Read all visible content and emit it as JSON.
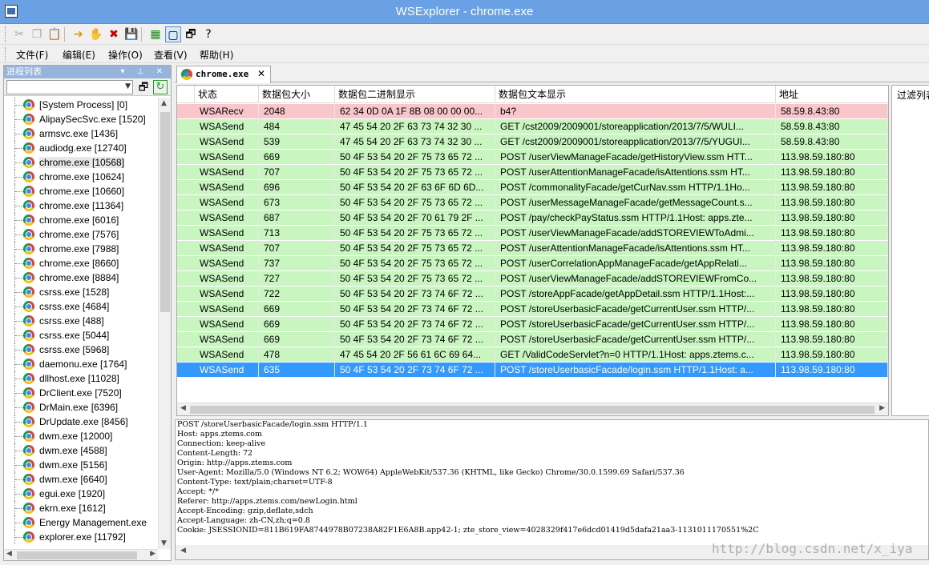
{
  "window": {
    "title": "WSExplorer - chrome.exe"
  },
  "toolbar": {
    "buttons": [
      {
        "name": "cut-icon",
        "glyph": "✂"
      },
      {
        "name": "copy-icon",
        "glyph": "❐"
      },
      {
        "name": "paste-icon",
        "glyph": "📋"
      },
      {
        "name": "arrow-right-icon",
        "glyph": "➜"
      },
      {
        "name": "hand-icon",
        "glyph": "✋"
      },
      {
        "name": "delete-x-icon",
        "glyph": "✖"
      },
      {
        "name": "save-icon",
        "glyph": "💾"
      },
      {
        "name": "tree-view-icon",
        "glyph": "▦"
      },
      {
        "name": "window-icon",
        "glyph": "▢"
      },
      {
        "name": "properties-icon",
        "glyph": "🗗"
      },
      {
        "name": "help-icon",
        "glyph": "?"
      }
    ]
  },
  "menu": [
    "文件(F)",
    "编辑(E)",
    "操作(O)",
    "查看(V)",
    "帮助(H)"
  ],
  "process_pane": {
    "title": "进程列表",
    "header_buttons": "▾ ⊥ ✕",
    "processes": [
      "[System Process] [0]",
      "AlipaySecSvc.exe [1520]",
      "armsvc.exe [1436]",
      "audiodg.exe [12740]",
      "chrome.exe [10568]",
      "chrome.exe [10624]",
      "chrome.exe [10660]",
      "chrome.exe [11364]",
      "chrome.exe [6016]",
      "chrome.exe [7576]",
      "chrome.exe [7988]",
      "chrome.exe [8660]",
      "chrome.exe [8884]",
      "csrss.exe [1528]",
      "csrss.exe [4684]",
      "csrss.exe [488]",
      "csrss.exe [5044]",
      "csrss.exe [5968]",
      "daemonu.exe [1764]",
      "dllhost.exe [11028]",
      "DrClient.exe [7520]",
      "DrMain.exe [6396]",
      "DrUpdate.exe [8456]",
      "dwm.exe [12000]",
      "dwm.exe [4588]",
      "dwm.exe [5156]",
      "dwm.exe [6640]",
      "egui.exe [1920]",
      "ekrn.exe [1612]",
      "Energy Management.exe",
      "explorer.exe [11792]"
    ],
    "selected_index": 4
  },
  "tab": {
    "label": "chrome.exe"
  },
  "grid": {
    "columns": [
      "状态",
      "数据包大小",
      "数据包二进制显示",
      "数据包文本显示",
      "地址"
    ],
    "rows": [
      {
        "type": "recv",
        "status": "WSARecv",
        "size": "2048",
        "hex": "62 34 0D 0A 1F 8B 08 00 00 00...",
        "text": "b4?",
        "addr": "58.59.8.43:80"
      },
      {
        "type": "send",
        "status": "WSASend",
        "size": "484",
        "hex": "47 45 54 20 2F 63 73 74 32 30 ...",
        "text": "GET /cst2009/2009001/storeapplication/2013/7/5/WULI...",
        "addr": "58.59.8.43:80"
      },
      {
        "type": "send",
        "status": "WSASend",
        "size": "539",
        "hex": "47 45 54 20 2F 63 73 74 32 30 ...",
        "text": "GET /cst2009/2009001/storeapplication/2013/7/5/YUGUI...",
        "addr": "58.59.8.43:80"
      },
      {
        "type": "send",
        "status": "WSASend",
        "size": "669",
        "hex": "50 4F 53 54 20 2F 75 73 65 72 ...",
        "text": "POST /userViewManageFacade/getHistoryView.ssm HTT...",
        "addr": "113.98.59.180:80"
      },
      {
        "type": "send",
        "status": "WSASend",
        "size": "707",
        "hex": "50 4F 53 54 20 2F 75 73 65 72 ...",
        "text": "POST /userAttentionManageFacade/isAttentions.ssm HT...",
        "addr": "113.98.59.180:80"
      },
      {
        "type": "send",
        "status": "WSASend",
        "size": "696",
        "hex": "50 4F 53 54 20 2F 63 6F 6D 6D...",
        "text": "POST /commonalityFacade/getCurNav.ssm HTTP/1.1Ho...",
        "addr": "113.98.59.180:80"
      },
      {
        "type": "send",
        "status": "WSASend",
        "size": "673",
        "hex": "50 4F 53 54 20 2F 75 73 65 72 ...",
        "text": "POST /userMessageManageFacade/getMessageCount.s...",
        "addr": "113.98.59.180:80"
      },
      {
        "type": "send",
        "status": "WSASend",
        "size": "687",
        "hex": "50 4F 53 54 20 2F 70 61 79 2F ...",
        "text": "POST /pay/checkPayStatus.ssm HTTP/1.1Host: apps.zte...",
        "addr": "113.98.59.180:80"
      },
      {
        "type": "send",
        "status": "WSASend",
        "size": "713",
        "hex": "50 4F 53 54 20 2F 75 73 65 72 ...",
        "text": "POST /userViewManageFacade/addSTOREVIEWToAdmi...",
        "addr": "113.98.59.180:80"
      },
      {
        "type": "send",
        "status": "WSASend",
        "size": "707",
        "hex": "50 4F 53 54 20 2F 75 73 65 72 ...",
        "text": "POST /userAttentionManageFacade/isAttentions.ssm HT...",
        "addr": "113.98.59.180:80"
      },
      {
        "type": "send",
        "status": "WSASend",
        "size": "737",
        "hex": "50 4F 53 54 20 2F 75 73 65 72 ...",
        "text": "POST /userCorrelationAppManageFacade/getAppRelati...",
        "addr": "113.98.59.180:80"
      },
      {
        "type": "send",
        "status": "WSASend",
        "size": "727",
        "hex": "50 4F 53 54 20 2F 75 73 65 72 ...",
        "text": "POST /userViewManageFacade/addSTOREVIEWFromCo...",
        "addr": "113.98.59.180:80"
      },
      {
        "type": "send",
        "status": "WSASend",
        "size": "722",
        "hex": "50 4F 53 54 20 2F 73 74 6F 72 ...",
        "text": "POST /storeAppFacade/getAppDetail.ssm HTTP/1.1Host:...",
        "addr": "113.98.59.180:80"
      },
      {
        "type": "send",
        "status": "WSASend",
        "size": "669",
        "hex": "50 4F 53 54 20 2F 73 74 6F 72 ...",
        "text": "POST /storeUserbasicFacade/getCurrentUser.ssm HTTP/...",
        "addr": "113.98.59.180:80"
      },
      {
        "type": "send",
        "status": "WSASend",
        "size": "669",
        "hex": "50 4F 53 54 20 2F 73 74 6F 72 ...",
        "text": "POST /storeUserbasicFacade/getCurrentUser.ssm HTTP/...",
        "addr": "113.98.59.180:80"
      },
      {
        "type": "send",
        "status": "WSASend",
        "size": "669",
        "hex": "50 4F 53 54 20 2F 73 74 6F 72 ...",
        "text": "POST /storeUserbasicFacade/getCurrentUser.ssm HTTP/...",
        "addr": "113.98.59.180:80"
      },
      {
        "type": "send",
        "status": "WSASend",
        "size": "478",
        "hex": "47 45 54 20 2F 56 61 6C 69 64...",
        "text": "GET /ValidCodeServlet?n=0 HTTP/1.1Host: apps.ztems.c...",
        "addr": "113.98.59.180:80"
      },
      {
        "type": "sel",
        "status": "WSASend",
        "size": "635",
        "hex": "50 4F 53 54 20 2F 73 74 6F 72 ...",
        "text": "POST /storeUserbasicFacade/login.ssm HTTP/1.1Host: a...",
        "addr": "113.98.59.180:80"
      }
    ]
  },
  "filter_pane": {
    "title": "过滤列表"
  },
  "detail": {
    "lines": [
      "POST /storeUserbasicFacade/login.ssm HTTP/1.1",
      "Host: apps.ztems.com",
      "Connection: keep-alive",
      "Content-Length: 72",
      "Origin: http://apps.ztems.com",
      "User-Agent: Mozilla/5.0 (Windows NT 6.2; WOW64) AppleWebKit/537.36 (KHTML, like Gecko) Chrome/30.0.1599.69 Safari/537.36",
      "Content-Type: text/plain;charset=UTF-8",
      "Accept: */*",
      "Referer: http://apps.ztems.com/newLogin.html",
      "Accept-Encoding: gzip,deflate,sdch",
      "Accept-Language: zh-CN,zh;q=0.8",
      "Cookie: JSESSIONID=811B619FA8744978B07238A82F1E6A8B.app42-1; zte_store_view=4028329f417e6dcd01419d5dafa21aa3-1131011170551%2C"
    ]
  },
  "watermark": "http://blog.csdn.net/x_iya",
  "colors": {
    "recv_row": "#f9c6cc",
    "send_row": "#c8f5c0",
    "selected_row": "#3399ff",
    "titlebar": "#6aa0e4"
  }
}
